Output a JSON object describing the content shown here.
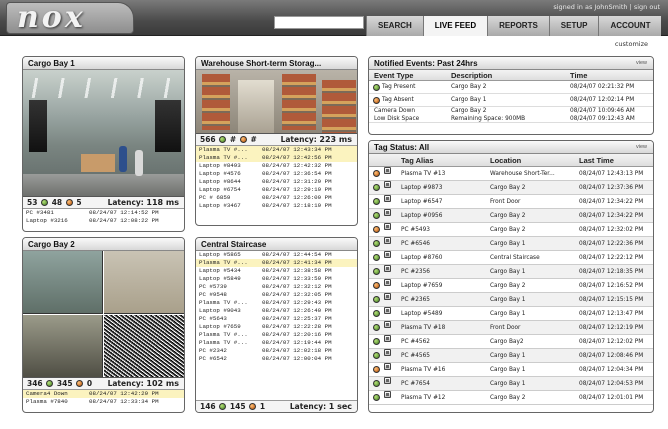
{
  "header": {
    "logo": "nox",
    "user_text": "signed in as JohnSmith",
    "separator": "|",
    "sign_out": "sign out",
    "nav": [
      "SEARCH",
      "LIVE FEED",
      "REPORTS",
      "SETUP",
      "ACCOUNT"
    ],
    "active_nav": "LIVE FEED",
    "customize": "customize"
  },
  "cameras": {
    "cargo_bay_1": {
      "title": "Cargo Bay 1",
      "green": "53",
      "green2": "48",
      "orange": "5",
      "latency_label": "Latency:",
      "latency": "118 ms",
      "rows": [
        {
          "name": "PC #3481",
          "time": "08/24/07 12:14:52 PM"
        },
        {
          "name": "Laptop #3216",
          "time": "08/24/07 12:08:22 PM"
        }
      ]
    },
    "warehouse": {
      "title": "Warehouse Short-term Storag...",
      "green": "566",
      "green2": "#",
      "orange": "#",
      "latency_label": "Latency:",
      "latency": "223 ms",
      "rows": [
        {
          "name": "Plasma TV #...",
          "time": "08/24/07 12:43:34 PM",
          "hl": true
        },
        {
          "name": "Plasma TV #...",
          "time": "08/24/07 12:42:56 PM",
          "hl": true
        },
        {
          "name": "Laptop #8493",
          "time": "08/24/07 12:42:32 PM"
        },
        {
          "name": "Laptop #4576",
          "time": "08/24/07 12:36:54 PM"
        },
        {
          "name": "Laptop #8644",
          "time": "08/24/07 12:31:29 PM"
        },
        {
          "name": "Laptop #6754",
          "time": "08/24/07 12:29:19 PM"
        },
        {
          "name": "PC # 6859",
          "time": "08/24/07 12:26:09 PM"
        },
        {
          "name": "Laptop #3467",
          "time": "08/24/07 12:18:19 PM"
        }
      ]
    },
    "cargo_bay_2": {
      "title": "Cargo Bay 2",
      "green": "346",
      "green2": "345",
      "orange": "0",
      "latency_label": "Latency:",
      "latency": "102 ms",
      "rows": [
        {
          "name": "Camera4 Down",
          "time": "08/24/07 12:42:29 PM",
          "hl": true
        },
        {
          "name": "Plasma #7840",
          "time": "08/24/07 12:33:34 PM"
        }
      ]
    },
    "central_staircase": {
      "title": "Central Staircase",
      "green": "146",
      "green2": "145",
      "orange": "1",
      "latency_label": "Latency:",
      "latency": "1 sec",
      "rows": [
        {
          "name": "Laptop #5865",
          "time": "08/24/07 12:44:54 PM"
        },
        {
          "name": "Plasma TV #...",
          "time": "08/24/07 12:41:34 PM",
          "hl": true
        },
        {
          "name": "Laptop #5434",
          "time": "08/24/07 12:38:58 PM"
        },
        {
          "name": "Laptop #5849",
          "time": "08/24/07 12:33:59 PM"
        },
        {
          "name": "PC #5739",
          "time": "08/24/07 12:32:12 PM"
        },
        {
          "name": "PC #9548",
          "time": "08/24/07 12:32:05 PM"
        },
        {
          "name": "Plasma TV #...",
          "time": "08/24/07 12:29:43 PM"
        },
        {
          "name": "Laptop #9043",
          "time": "08/24/07 12:26:40 PM"
        },
        {
          "name": "PC #5643",
          "time": "08/24/07 12:25:37 PM"
        },
        {
          "name": "Laptop #7659",
          "time": "08/24/07 12:22:28 PM"
        },
        {
          "name": "Plasma TV #...",
          "time": "08/24/07 12:20:16 PM"
        },
        {
          "name": "Plasma TV #...",
          "time": "08/24/07 12:19:44 PM"
        },
        {
          "name": "PC #2342",
          "time": "08/24/07 12:02:18 PM"
        },
        {
          "name": "PC #6542",
          "time": "08/24/07 12:00:04 PM"
        }
      ]
    }
  },
  "events": {
    "title": "Notified Events:  Past 24hrs",
    "view": "view",
    "headers": [
      "Event Type",
      "Description",
      "Time"
    ],
    "rows": [
      {
        "status": "g",
        "type": "Tag Present",
        "desc": "Cargo Bay 2",
        "time": "08/24/07 02:21:32 PM"
      },
      {
        "status": "o",
        "type": "Tag Absent",
        "desc": "Cargo Bay 1",
        "time": "08/24/07 12:02:14 PM"
      },
      {
        "status": "",
        "type": "Camera Down",
        "desc": "Cargo Bay 2",
        "time": "08/24/07 10:09:46 AM"
      },
      {
        "status": "",
        "type": "Low Disk Space",
        "desc": "Remaining Space: 900MB",
        "time": "08/24/07 09:12:43 AM"
      }
    ]
  },
  "tags": {
    "title": "Tag Status:  All",
    "view": "view",
    "headers": [
      "Tag Alias",
      "Location",
      "Last Time"
    ],
    "rows": [
      {
        "status": "o",
        "alias": "Plasma TV #13",
        "loc": "Warehouse Short-Ter...",
        "time": "08/24/07 12:43:13 PM"
      },
      {
        "status": "g",
        "alias": "Laptop #9873",
        "loc": "Cargo Bay 2",
        "time": "08/24/07 12:37:36 PM"
      },
      {
        "status": "g",
        "alias": "Laptop #6547",
        "loc": "Front Door",
        "time": "08/24/07 12:34:22 PM"
      },
      {
        "status": "g",
        "alias": "Laptop #0956",
        "loc": "Cargo Bay 2",
        "time": "08/24/07 12:34:22 PM"
      },
      {
        "status": "o",
        "alias": "PC #5493",
        "loc": "Cargo Bay 2",
        "time": "08/24/07 12:32:02 PM"
      },
      {
        "status": "g",
        "alias": "PC #6546",
        "loc": "Cargo Bay 1",
        "time": "08/24/07 12:22:36 PM"
      },
      {
        "status": "g",
        "alias": "Laptop #8760",
        "loc": "Central Staircase",
        "time": "08/24/07 12:22:12 PM"
      },
      {
        "status": "g",
        "alias": "PC #2356",
        "loc": "Cargo Bay 1",
        "time": "08/24/07 12:18:35 PM"
      },
      {
        "status": "o",
        "alias": "Laptop #7659",
        "loc": "Cargo Bay 2",
        "time": "08/24/07 12:16:52 PM"
      },
      {
        "status": "g",
        "alias": "PC #2365",
        "loc": "Cargo Bay 1",
        "time": "08/24/07 12:15:15 PM"
      },
      {
        "status": "g",
        "alias": "Laptop #5489",
        "loc": "Cargo Bay 1",
        "time": "08/24/07 12:13:47 PM"
      },
      {
        "status": "g",
        "alias": "Plasma TV #18",
        "loc": "Front Door",
        "time": "08/24/07 12:12:19 PM"
      },
      {
        "status": "g",
        "alias": "PC #4562",
        "loc": "Cargo Bay2",
        "time": "08/24/07 12:12:02 PM"
      },
      {
        "status": "g",
        "alias": "PC #4565",
        "loc": "Cargo Bay 1",
        "time": "08/24/07 12:08:46 PM"
      },
      {
        "status": "o",
        "alias": "Plasma TV #16",
        "loc": "Cargo Bay 1",
        "time": "08/24/07 12:04:34 PM"
      },
      {
        "status": "g",
        "alias": "PC #7654",
        "loc": "Cargo Bay 1",
        "time": "08/24/07 12:04:53 PM"
      },
      {
        "status": "g",
        "alias": "Plasma TV #12",
        "loc": "Cargo Bay 2",
        "time": "08/24/07 12:01:01 PM"
      }
    ]
  }
}
